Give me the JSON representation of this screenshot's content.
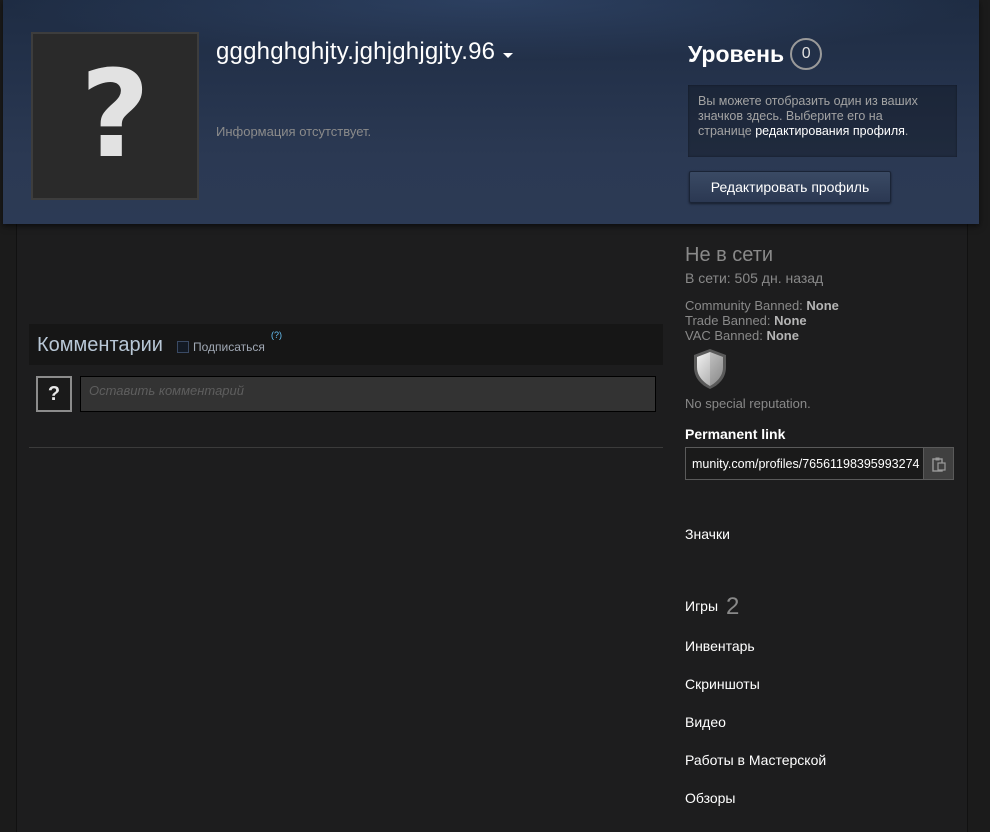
{
  "profile": {
    "username": "ggghghghjty.jghjghjgjty.96",
    "summary": "Информация отсутствует.",
    "avatar_glyph": "?",
    "level_label": "Уровень",
    "level_value": "0",
    "badge_text_1": "Вы можете отобразить один из ваших",
    "badge_text_2": "значков здесь. Выберите его на",
    "badge_text_3": "странице",
    "badge_link": "редактирования профиля",
    "badge_text_end": ".",
    "edit_button": "Редактировать профиль"
  },
  "comments": {
    "title": "Комментарии",
    "subscribe_label": "Подписаться",
    "help": "(?)",
    "avatar_glyph": "?",
    "placeholder": "Оставить комментарий"
  },
  "sidebar": {
    "status": "Не в сети",
    "last_online": "В сети: 505 дн. назад",
    "bans": [
      {
        "label": "Community Banned:",
        "value": "None"
      },
      {
        "label": "Trade Banned:",
        "value": "None"
      },
      {
        "label": "VAC Banned:",
        "value": "None"
      }
    ],
    "reputation": "No special reputation.",
    "permanent_link_label": "Permanent link",
    "permanent_link_value": "munity.com/profiles/76561198395993274",
    "links": {
      "badges": "Значки",
      "games": "Игры",
      "games_count": "2",
      "inventory": "Инвентарь",
      "screenshots": "Скриншоты",
      "videos": "Видео",
      "workshop": "Работы в Мастерской",
      "reviews": "Обзоры"
    }
  }
}
